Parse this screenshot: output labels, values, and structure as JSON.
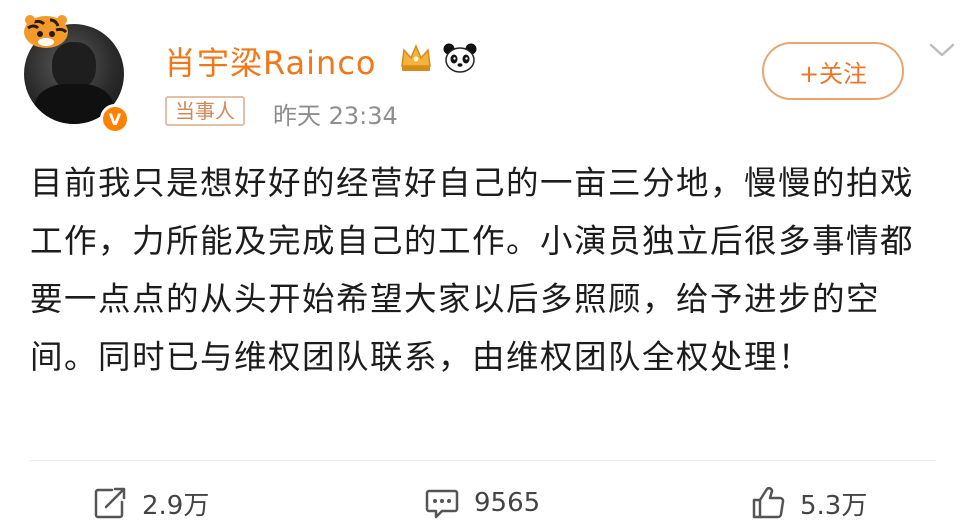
{
  "post": {
    "username": "肖宇梁Rainco",
    "tag": "当事人",
    "time": "昨天 23:34",
    "follow_label": "+关注",
    "content": "目前我只是想好好的经营好自己的一亩三分地，慢慢的拍戏工作，力所能及完成自己的工作。小演员独立后很多事情都要一点点的从头开始希望大家以后多照顾，给予进步的空间。同时已与维权团队联系，由维权团队全权处理！"
  },
  "actions": {
    "repost_count": "2.9万",
    "comment_count": "9565",
    "like_count": "5.3万"
  },
  "badge": {
    "verified_symbol": "V"
  },
  "colors": {
    "accent": "#f0771a",
    "verified": "#ff8200",
    "tag_border": "#e3bfa3"
  },
  "icons": [
    "tiger-icon",
    "verified-badge-icon",
    "crown-icon",
    "panda-icon",
    "chevron-down-icon",
    "repost-icon",
    "comment-icon",
    "like-icon"
  ]
}
